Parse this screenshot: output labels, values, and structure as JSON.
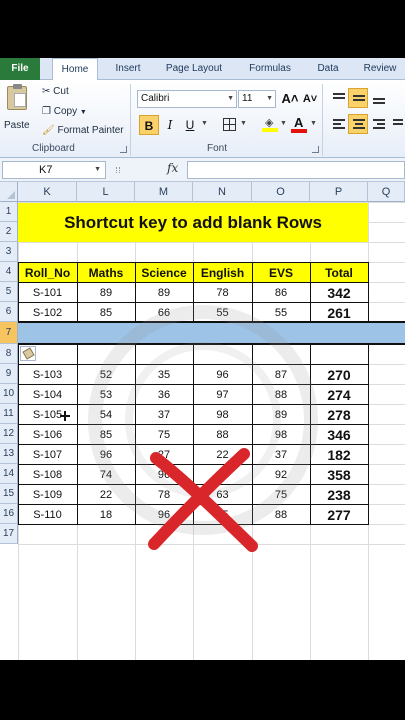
{
  "tabs": [
    "File",
    "Home",
    "Insert",
    "Page Layout",
    "Formulas",
    "Data",
    "Review"
  ],
  "ribbon": {
    "clipboard": {
      "paste": "Paste",
      "cut": "Cut",
      "copy": "Copy",
      "format_painter": "Format Painter",
      "label": "Clipboard"
    },
    "font": {
      "family": "Calibri",
      "size": "11",
      "grow_icon": "A˄",
      "shrink_icon": "A˅",
      "bold": "B",
      "italic": "I",
      "underline": "U",
      "font_color_letter": "A",
      "label": "Font"
    }
  },
  "formula_bar": {
    "name_box": "K7",
    "fx": "fx",
    "value": ""
  },
  "columns": [
    "K",
    "L",
    "M",
    "N",
    "O",
    "P",
    "Q"
  ],
  "rows": [
    "1",
    "2",
    "3",
    "4",
    "5",
    "6",
    "7",
    "8",
    "9",
    "10",
    "11",
    "12",
    "13",
    "14",
    "15",
    "16",
    "17"
  ],
  "sheet": {
    "title": "Shortcut key to add blank Rows",
    "headers": [
      "Roll_No",
      "Maths",
      "Science",
      "English",
      "EVS",
      "Total"
    ],
    "records": [
      [
        "S-101",
        "89",
        "89",
        "78",
        "86",
        "342"
      ],
      [
        "S-102",
        "85",
        "66",
        "55",
        "55",
        "261"
      ],
      null,
      null,
      [
        "S-103",
        "52",
        "35",
        "96",
        "87",
        "270"
      ],
      [
        "S-104",
        "53",
        "36",
        "97",
        "88",
        "274"
      ],
      [
        "S-105",
        "54",
        "37",
        "98",
        "89",
        "278"
      ],
      [
        "S-106",
        "85",
        "75",
        "88",
        "98",
        "346"
      ],
      [
        "S-107",
        "96",
        "27",
        "22",
        "37",
        "182"
      ],
      [
        "S-108",
        "74",
        "96",
        "96",
        "92",
        "358"
      ],
      [
        "S-109",
        "22",
        "78",
        "63",
        "75",
        "238"
      ],
      [
        "S-110",
        "18",
        "96",
        "75",
        "88",
        "277"
      ]
    ]
  },
  "colors": {
    "title_fill": "#ffff00",
    "selection": "#9dc3e6",
    "file_tab": "#2a7a3b",
    "x_mark": "#d9262b"
  }
}
